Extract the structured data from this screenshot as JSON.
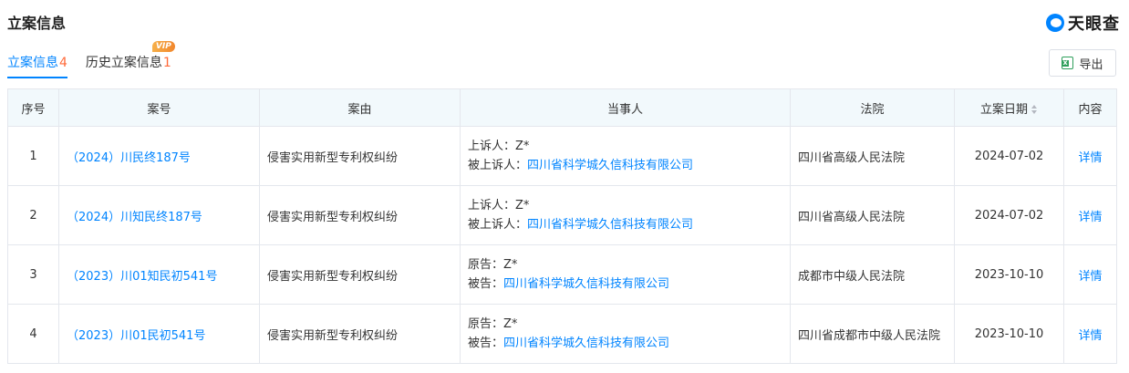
{
  "page": {
    "title": "立案信息"
  },
  "logo": {
    "text": "天眼查",
    "icon": "tianyancha-logo-icon"
  },
  "tabs": [
    {
      "label": "立案信息",
      "count": "4",
      "active": true
    },
    {
      "label": "历史立案信息",
      "count": "1",
      "badge": "VIP",
      "active": false
    }
  ],
  "toolbar": {
    "export_label": "导出",
    "export_icon": "excel-icon"
  },
  "table": {
    "headers": {
      "index": "序号",
      "case_no": "案号",
      "cause": "案由",
      "parties": "当事人",
      "court": "法院",
      "date": "立案日期",
      "detail": "内容"
    },
    "rows": [
      {
        "index": "1",
        "case_no": "（2024）川民终187号",
        "cause": "侵害实用新型专利权纠纷",
        "party1_role": "上诉人：",
        "party1_name": "Z*",
        "party2_role": "被上诉人：",
        "party2_name": "四川省科学城久信科技有限公司",
        "court": "四川省高级人民法院",
        "date": "2024-07-02",
        "detail": "详情"
      },
      {
        "index": "2",
        "case_no": "（2024）川知民终187号",
        "cause": "侵害实用新型专利权纠纷",
        "party1_role": "上诉人：",
        "party1_name": "Z*",
        "party2_role": "被上诉人：",
        "party2_name": "四川省科学城久信科技有限公司",
        "court": "四川省高级人民法院",
        "date": "2024-07-02",
        "detail": "详情"
      },
      {
        "index": "3",
        "case_no": "（2023）川01知民初541号",
        "cause": "侵害实用新型专利权纠纷",
        "party1_role": "原告：",
        "party1_name": "Z*",
        "party2_role": "被告：",
        "party2_name": "四川省科学城久信科技有限公司",
        "court": "成都市中级人民法院",
        "date": "2023-10-10",
        "detail": "详情"
      },
      {
        "index": "4",
        "case_no": "（2023）川01民初541号",
        "cause": "侵害实用新型专利权纠纷",
        "party1_role": "原告：",
        "party1_name": "Z*",
        "party2_role": "被告：",
        "party2_name": "四川省科学城久信科技有限公司",
        "court": "四川省成都市中级人民法院",
        "date": "2023-10-10",
        "detail": "详情"
      }
    ]
  },
  "colors": {
    "accent": "#0084ff",
    "count": "#ff6a3a",
    "header_bg": "#f2f9fc",
    "border": "#e4e7ed"
  }
}
